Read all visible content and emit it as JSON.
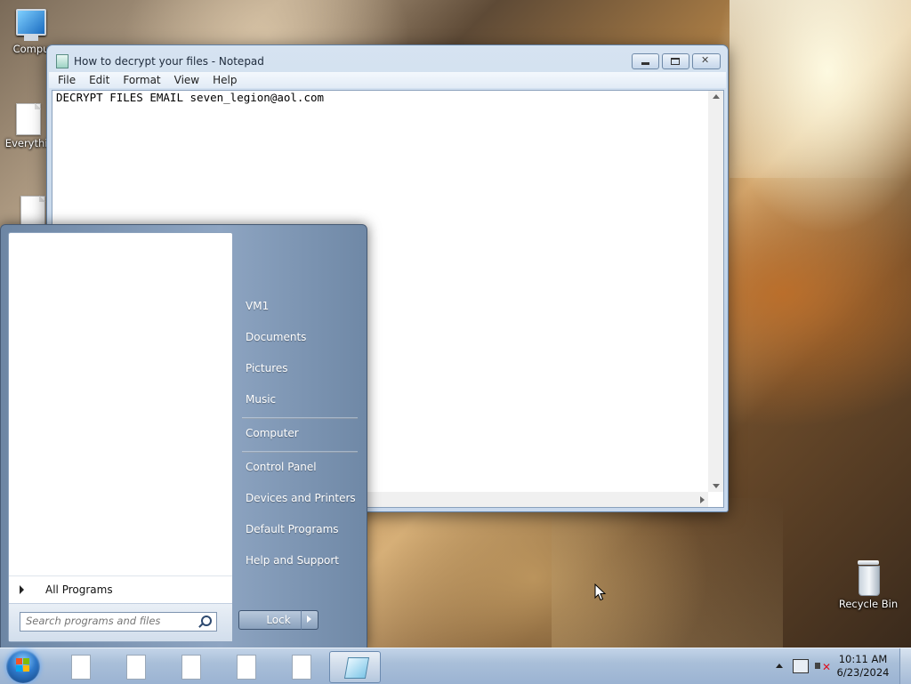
{
  "desktop": {
    "icons": [
      {
        "label": "Compu"
      },
      {
        "label": "Everythir"
      },
      {
        "label": "Recycle Bin"
      }
    ]
  },
  "notepad": {
    "title": "How to decrypt your files - Notepad",
    "menu": [
      "File",
      "Edit",
      "Format",
      "View",
      "Help"
    ],
    "content": "DECRYPT FILES EMAIL seven_legion@aol.com"
  },
  "start_menu": {
    "all_programs_label": "All Programs",
    "search_placeholder": "Search programs and files",
    "right_items": [
      "VM1",
      "Documents",
      "Pictures",
      "Music",
      "Computer",
      "Control Panel",
      "Devices and Printers",
      "Default Programs",
      "Help and Support"
    ],
    "lock_label": "Lock"
  },
  "taskbar": {
    "pinned": [
      "doc",
      "doc",
      "doc",
      "doc",
      "doc",
      "notepad"
    ],
    "clock_time": "10:11 AM",
    "clock_date": "6/23/2024"
  },
  "colors": {
    "start_menu_right": "#8ea5c2",
    "taskbar": "#a9bfd9",
    "volume_muted": "#d12222"
  }
}
